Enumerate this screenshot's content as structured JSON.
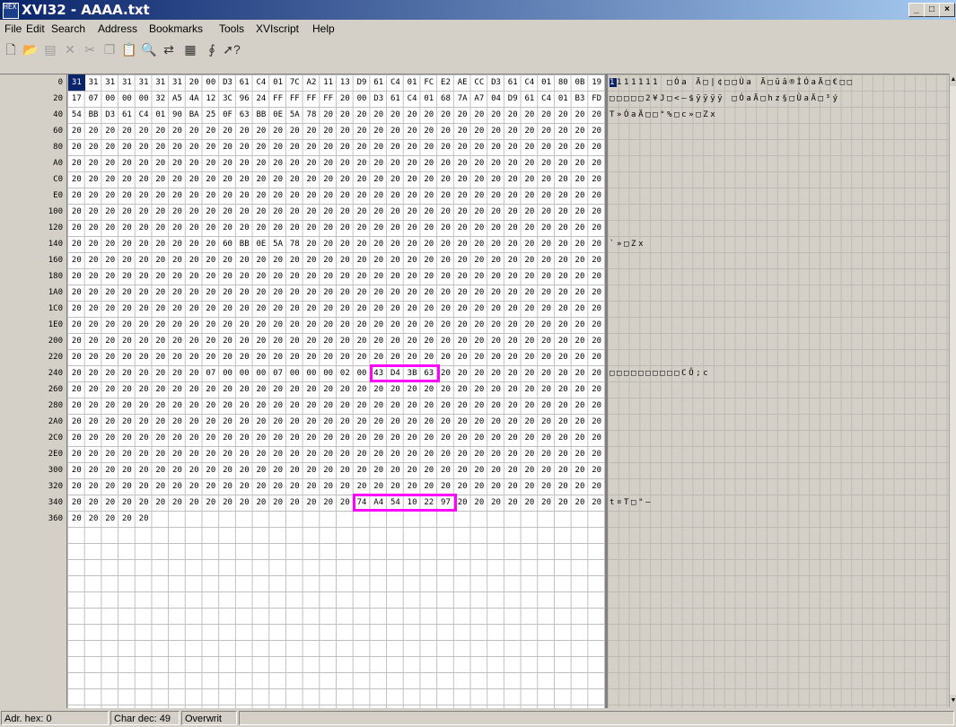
{
  "window": {
    "title": "XVI32 - AAAA.txt",
    "app_icon_text": "HEX"
  },
  "menu": [
    "File",
    "Edit",
    "Search",
    "Address",
    "Bookmarks",
    "Tools",
    "XVIscript",
    "Help"
  ],
  "toolbar": [
    "new-icon",
    "open-icon",
    "save-icon",
    "delete-icon",
    "cut-icon",
    "copy-icon",
    "paste-icon",
    "find-icon",
    "replace-icon",
    "goto-icon",
    "script-icon",
    "help-icon"
  ],
  "hex": {
    "addresses": [
      "0",
      "20",
      "40",
      "60",
      "80",
      "A0",
      "C0",
      "E0",
      "100",
      "120",
      "140",
      "160",
      "180",
      "1A0",
      "1C0",
      "1E0",
      "200",
      "220",
      "240",
      "260",
      "280",
      "2A0",
      "2C0",
      "2E0",
      "300",
      "320",
      "340",
      "360"
    ],
    "rows": [
      [
        "31",
        "31",
        "31",
        "31",
        "31",
        "31",
        "31",
        "20",
        "00",
        "D3",
        "61",
        "C4",
        "01",
        "7C",
        "A2",
        "11",
        "13",
        "D9",
        "61",
        "C4",
        "01",
        "FC",
        "E2",
        "AE",
        "CC",
        "D3",
        "61",
        "C4",
        "01",
        "80",
        "0B",
        "19"
      ],
      [
        "17",
        "07",
        "00",
        "00",
        "00",
        "32",
        "A5",
        "4A",
        "12",
        "3C",
        "96",
        "24",
        "FF",
        "FF",
        "FF",
        "FF",
        "20",
        "00",
        "D3",
        "61",
        "C4",
        "01",
        "68",
        "7A",
        "A7",
        "04",
        "D9",
        "61",
        "C4",
        "01",
        "B3",
        "FD"
      ],
      [
        "54",
        "BB",
        "D3",
        "61",
        "C4",
        "01",
        "90",
        "BA",
        "25",
        "0F",
        "63",
        "BB",
        "0E",
        "5A",
        "78",
        "20",
        "20",
        "20",
        "20",
        "20",
        "20",
        "20",
        "20",
        "20",
        "20",
        "20",
        "20",
        "20",
        "20",
        "20",
        "20",
        "20"
      ],
      [
        "20",
        "20",
        "20",
        "20",
        "20",
        "20",
        "20",
        "20",
        "20",
        "20",
        "20",
        "20",
        "20",
        "20",
        "20",
        "20",
        "20",
        "20",
        "20",
        "20",
        "20",
        "20",
        "20",
        "20",
        "20",
        "20",
        "20",
        "20",
        "20",
        "20",
        "20",
        "20"
      ],
      [
        "20",
        "20",
        "20",
        "20",
        "20",
        "20",
        "20",
        "20",
        "20",
        "20",
        "20",
        "20",
        "20",
        "20",
        "20",
        "20",
        "20",
        "20",
        "20",
        "20",
        "20",
        "20",
        "20",
        "20",
        "20",
        "20",
        "20",
        "20",
        "20",
        "20",
        "20",
        "20"
      ],
      [
        "20",
        "20",
        "20",
        "20",
        "20",
        "20",
        "20",
        "20",
        "20",
        "20",
        "20",
        "20",
        "20",
        "20",
        "20",
        "20",
        "20",
        "20",
        "20",
        "20",
        "20",
        "20",
        "20",
        "20",
        "20",
        "20",
        "20",
        "20",
        "20",
        "20",
        "20",
        "20"
      ],
      [
        "20",
        "20",
        "20",
        "20",
        "20",
        "20",
        "20",
        "20",
        "20",
        "20",
        "20",
        "20",
        "20",
        "20",
        "20",
        "20",
        "20",
        "20",
        "20",
        "20",
        "20",
        "20",
        "20",
        "20",
        "20",
        "20",
        "20",
        "20",
        "20",
        "20",
        "20",
        "20"
      ],
      [
        "20",
        "20",
        "20",
        "20",
        "20",
        "20",
        "20",
        "20",
        "20",
        "20",
        "20",
        "20",
        "20",
        "20",
        "20",
        "20",
        "20",
        "20",
        "20",
        "20",
        "20",
        "20",
        "20",
        "20",
        "20",
        "20",
        "20",
        "20",
        "20",
        "20",
        "20",
        "20"
      ],
      [
        "20",
        "20",
        "20",
        "20",
        "20",
        "20",
        "20",
        "20",
        "20",
        "20",
        "20",
        "20",
        "20",
        "20",
        "20",
        "20",
        "20",
        "20",
        "20",
        "20",
        "20",
        "20",
        "20",
        "20",
        "20",
        "20",
        "20",
        "20",
        "20",
        "20",
        "20",
        "20"
      ],
      [
        "20",
        "20",
        "20",
        "20",
        "20",
        "20",
        "20",
        "20",
        "20",
        "20",
        "20",
        "20",
        "20",
        "20",
        "20",
        "20",
        "20",
        "20",
        "20",
        "20",
        "20",
        "20",
        "20",
        "20",
        "20",
        "20",
        "20",
        "20",
        "20",
        "20",
        "20",
        "20"
      ],
      [
        "20",
        "20",
        "20",
        "20",
        "20",
        "20",
        "20",
        "20",
        "20",
        "60",
        "BB",
        "0E",
        "5A",
        "78",
        "20",
        "20",
        "20",
        "20",
        "20",
        "20",
        "20",
        "20",
        "20",
        "20",
        "20",
        "20",
        "20",
        "20",
        "20",
        "20",
        "20",
        "20"
      ],
      [
        "20",
        "20",
        "20",
        "20",
        "20",
        "20",
        "20",
        "20",
        "20",
        "20",
        "20",
        "20",
        "20",
        "20",
        "20",
        "20",
        "20",
        "20",
        "20",
        "20",
        "20",
        "20",
        "20",
        "20",
        "20",
        "20",
        "20",
        "20",
        "20",
        "20",
        "20",
        "20"
      ],
      [
        "20",
        "20",
        "20",
        "20",
        "20",
        "20",
        "20",
        "20",
        "20",
        "20",
        "20",
        "20",
        "20",
        "20",
        "20",
        "20",
        "20",
        "20",
        "20",
        "20",
        "20",
        "20",
        "20",
        "20",
        "20",
        "20",
        "20",
        "20",
        "20",
        "20",
        "20",
        "20"
      ],
      [
        "20",
        "20",
        "20",
        "20",
        "20",
        "20",
        "20",
        "20",
        "20",
        "20",
        "20",
        "20",
        "20",
        "20",
        "20",
        "20",
        "20",
        "20",
        "20",
        "20",
        "20",
        "20",
        "20",
        "20",
        "20",
        "20",
        "20",
        "20",
        "20",
        "20",
        "20",
        "20"
      ],
      [
        "20",
        "20",
        "20",
        "20",
        "20",
        "20",
        "20",
        "20",
        "20",
        "20",
        "20",
        "20",
        "20",
        "20",
        "20",
        "20",
        "20",
        "20",
        "20",
        "20",
        "20",
        "20",
        "20",
        "20",
        "20",
        "20",
        "20",
        "20",
        "20",
        "20",
        "20",
        "20"
      ],
      [
        "20",
        "20",
        "20",
        "20",
        "20",
        "20",
        "20",
        "20",
        "20",
        "20",
        "20",
        "20",
        "20",
        "20",
        "20",
        "20",
        "20",
        "20",
        "20",
        "20",
        "20",
        "20",
        "20",
        "20",
        "20",
        "20",
        "20",
        "20",
        "20",
        "20",
        "20",
        "20"
      ],
      [
        "20",
        "20",
        "20",
        "20",
        "20",
        "20",
        "20",
        "20",
        "20",
        "20",
        "20",
        "20",
        "20",
        "20",
        "20",
        "20",
        "20",
        "20",
        "20",
        "20",
        "20",
        "20",
        "20",
        "20",
        "20",
        "20",
        "20",
        "20",
        "20",
        "20",
        "20",
        "20"
      ],
      [
        "20",
        "20",
        "20",
        "20",
        "20",
        "20",
        "20",
        "20",
        "20",
        "20",
        "20",
        "20",
        "20",
        "20",
        "20",
        "20",
        "20",
        "20",
        "20",
        "20",
        "20",
        "20",
        "20",
        "20",
        "20",
        "20",
        "20",
        "20",
        "20",
        "20",
        "20",
        "20"
      ],
      [
        "20",
        "20",
        "20",
        "20",
        "20",
        "20",
        "20",
        "20",
        "07",
        "00",
        "00",
        "00",
        "07",
        "00",
        "00",
        "00",
        "02",
        "00",
        "43",
        "D4",
        "3B",
        "63",
        "20",
        "20",
        "20",
        "20",
        "20",
        "20",
        "20",
        "20",
        "20",
        "20"
      ],
      [
        "20",
        "20",
        "20",
        "20",
        "20",
        "20",
        "20",
        "20",
        "20",
        "20",
        "20",
        "20",
        "20",
        "20",
        "20",
        "20",
        "20",
        "20",
        "20",
        "20",
        "20",
        "20",
        "20",
        "20",
        "20",
        "20",
        "20",
        "20",
        "20",
        "20",
        "20",
        "20"
      ],
      [
        "20",
        "20",
        "20",
        "20",
        "20",
        "20",
        "20",
        "20",
        "20",
        "20",
        "20",
        "20",
        "20",
        "20",
        "20",
        "20",
        "20",
        "20",
        "20",
        "20",
        "20",
        "20",
        "20",
        "20",
        "20",
        "20",
        "20",
        "20",
        "20",
        "20",
        "20",
        "20"
      ],
      [
        "20",
        "20",
        "20",
        "20",
        "20",
        "20",
        "20",
        "20",
        "20",
        "20",
        "20",
        "20",
        "20",
        "20",
        "20",
        "20",
        "20",
        "20",
        "20",
        "20",
        "20",
        "20",
        "20",
        "20",
        "20",
        "20",
        "20",
        "20",
        "20",
        "20",
        "20",
        "20"
      ],
      [
        "20",
        "20",
        "20",
        "20",
        "20",
        "20",
        "20",
        "20",
        "20",
        "20",
        "20",
        "20",
        "20",
        "20",
        "20",
        "20",
        "20",
        "20",
        "20",
        "20",
        "20",
        "20",
        "20",
        "20",
        "20",
        "20",
        "20",
        "20",
        "20",
        "20",
        "20",
        "20"
      ],
      [
        "20",
        "20",
        "20",
        "20",
        "20",
        "20",
        "20",
        "20",
        "20",
        "20",
        "20",
        "20",
        "20",
        "20",
        "20",
        "20",
        "20",
        "20",
        "20",
        "20",
        "20",
        "20",
        "20",
        "20",
        "20",
        "20",
        "20",
        "20",
        "20",
        "20",
        "20",
        "20"
      ],
      [
        "20",
        "20",
        "20",
        "20",
        "20",
        "20",
        "20",
        "20",
        "20",
        "20",
        "20",
        "20",
        "20",
        "20",
        "20",
        "20",
        "20",
        "20",
        "20",
        "20",
        "20",
        "20",
        "20",
        "20",
        "20",
        "20",
        "20",
        "20",
        "20",
        "20",
        "20",
        "20"
      ],
      [
        "20",
        "20",
        "20",
        "20",
        "20",
        "20",
        "20",
        "20",
        "20",
        "20",
        "20",
        "20",
        "20",
        "20",
        "20",
        "20",
        "20",
        "20",
        "20",
        "20",
        "20",
        "20",
        "20",
        "20",
        "20",
        "20",
        "20",
        "20",
        "20",
        "20",
        "20",
        "20"
      ],
      [
        "20",
        "20",
        "20",
        "20",
        "20",
        "20",
        "20",
        "20",
        "20",
        "20",
        "20",
        "20",
        "20",
        "20",
        "20",
        "20",
        "20",
        "74",
        "A4",
        "54",
        "10",
        "22",
        "97",
        "20",
        "20",
        "20",
        "20",
        "20",
        "20",
        "20",
        "20",
        "20"
      ],
      [
        "20",
        "20",
        "20",
        "20",
        "20"
      ]
    ]
  },
  "text_rows": [
    "1111111 □Óa Ä□|¢□□Ùa Ä□üâ®ÌÓaÄ□€□□",
    "□□□□□2¥J□<–$ÿÿÿÿ □ÓaÄ□hz§□ÙaÄ□³ý",
    "T»ÓaÄ□□°%□c»□Zx",
    "",
    "",
    "",
    "",
    "",
    "",
    "",
    "         `»□Zx",
    "",
    "",
    "",
    "",
    "",
    "",
    "",
    "        □□□□□□□□□□CÔ;c",
    "",
    "",
    "",
    "",
    "",
    "",
    "",
    "                 t¤T□\"—",
    ""
  ],
  "status": {
    "addr": "Adr. hex: 0",
    "char": "Char dec: 49",
    "mode": "Overwrit"
  },
  "colors": {
    "highlight": "#ff00ff",
    "selection": "#0a246a"
  }
}
